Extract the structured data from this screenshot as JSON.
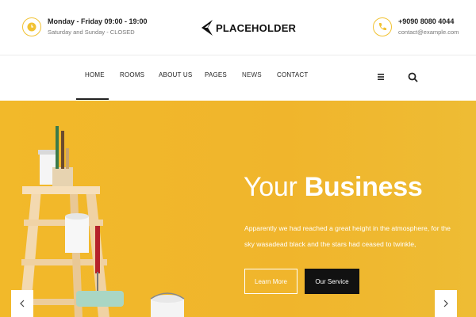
{
  "topbar": {
    "hours_title": "Monday - Friday 09:00 - 19:00",
    "hours_sub": "Saturday and Sunday - CLOSED",
    "phone": "+9090 8080 4044",
    "email": "contact@example.com"
  },
  "logo": {
    "text": "PLACEHOLDER"
  },
  "nav": {
    "items": [
      {
        "label": "HOME"
      },
      {
        "label": "ROOMS"
      },
      {
        "label": "ABOUT US"
      },
      {
        "label": "PAGES"
      },
      {
        "label": "NEWS"
      },
      {
        "label": "CONTACT"
      }
    ],
    "active": "HOME"
  },
  "hero": {
    "title_light": "Your",
    "title_bold": "Business",
    "description": "Apparently we had reached a great height in the atmosphere, for the sky wasadead black and the stars had ceased to twinkle,",
    "btn_learn": "Learn More",
    "btn_service": "Our Service"
  },
  "colors": {
    "accent": "#f0b62b",
    "dark": "#111111"
  },
  "icons": [
    "clock-icon",
    "phone-icon",
    "logo-arrow-icon",
    "menu-icon",
    "search-icon",
    "chevron-left-icon",
    "chevron-right-icon"
  ]
}
